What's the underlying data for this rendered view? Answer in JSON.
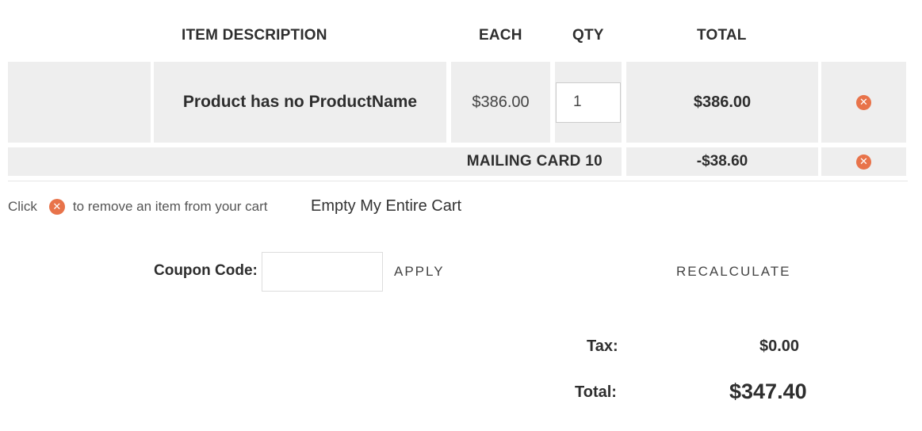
{
  "cart": {
    "headers": {
      "description": "ITEM  DESCRIPTION",
      "each": "EACH",
      "qty": "QTY",
      "total": "TOTAL"
    },
    "items": [
      {
        "name": "Product has no ProductName",
        "price_each": "$386.00",
        "qty": "1",
        "total": "$386.00",
        "remove_icon": "remove-x-circle-icon"
      }
    ],
    "discount": {
      "label": "MAILING CARD 10",
      "amount": "-$38.60",
      "remove_icon": "remove-x-circle-icon"
    },
    "hint": {
      "prefix": "Click",
      "suffix": "to remove an item from your cart"
    },
    "empty_cart_label": "Empty My Entire Cart",
    "coupon": {
      "label": "Coupon Code:",
      "value": "",
      "placeholder": "",
      "apply_label": "APPLY"
    },
    "recalculate_label": "RECALCULATE",
    "summary": {
      "tax_label": "Tax:",
      "tax_value": "$0.00",
      "total_label": "Total:",
      "total_value": "$347.40"
    }
  },
  "colors": {
    "accent_remove": "#e8734a",
    "row_background": "#eeeeee",
    "text": "#333333"
  }
}
